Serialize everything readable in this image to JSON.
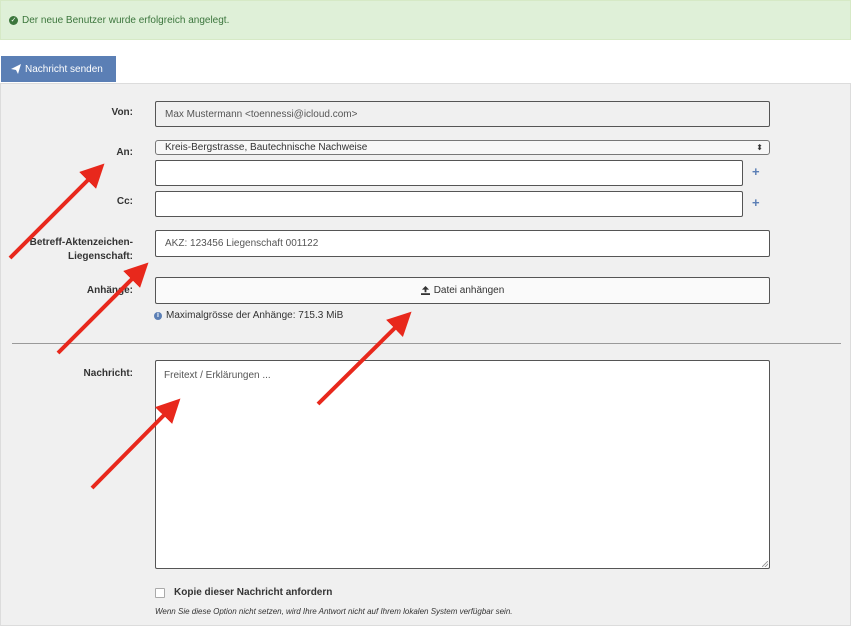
{
  "alert": {
    "message": "Der neue Benutzer wurde erfolgreich angelegt.",
    "icon": "check-circle-icon"
  },
  "toolbar": {
    "send_label": "Nachricht senden",
    "send_icon": "paper-plane-icon"
  },
  "form": {
    "from": {
      "label": "Von:",
      "value": "Max Mustermann <toennessi@icloud.com>"
    },
    "to": {
      "label": "An:",
      "selected": "Kreis-Bergstrasse, Bautechnische Nachweise",
      "extra_value": "",
      "add_symbol": "+"
    },
    "cc": {
      "label": "Cc:",
      "value": "",
      "add_symbol": "+"
    },
    "subject": {
      "label_line1": "Betreff-Aktenzeichen-",
      "label_line2": "Liegenschaft:",
      "value": "AKZ: 123456 Liegenschaft 001122"
    },
    "attachments": {
      "label": "Anhänge:",
      "button_label": "Datei anhängen",
      "button_icon": "upload-icon",
      "info_icon": "info-icon",
      "info_text": "Maximalgrösse der Anhänge: 715.3 MiB"
    },
    "message": {
      "label": "Nachricht:",
      "placeholder": "Freitext / Erklärungen ...",
      "value": ""
    },
    "copy": {
      "checkbox_label": "Kopie dieser Nachricht anfordern",
      "checked": false,
      "hint": "Wenn Sie diese Option nicht setzen, wird Ihre Antwort nicht auf Ihrem lokalen System verfügbar sein."
    }
  },
  "colors": {
    "accent": "#5b7fb5",
    "success_bg": "#dff0d8",
    "success_text": "#3c763d",
    "annotation_arrow": "#e8281c"
  }
}
